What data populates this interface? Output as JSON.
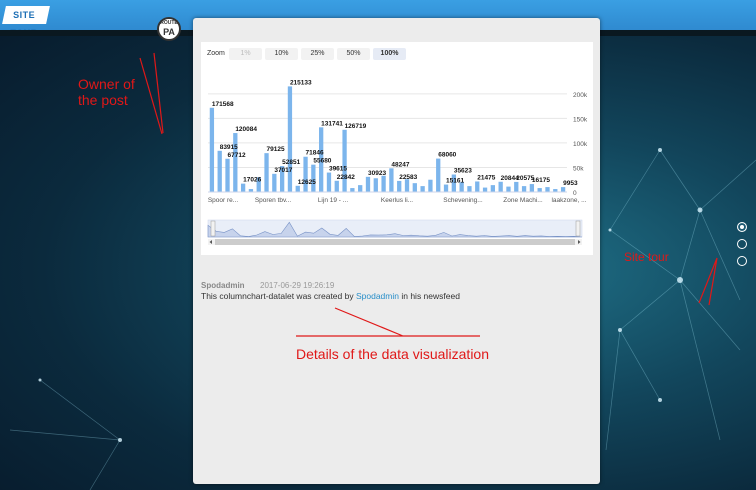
{
  "app": {
    "logo_text": "SITE TOUR"
  },
  "avatar": {
    "top_text": "ROUTE",
    "initials": "PA"
  },
  "chart": {
    "zoom_label": "Zoom",
    "zoom_options": [
      "1%",
      "10%",
      "25%",
      "50%",
      "100%"
    ],
    "zoom_selected": "100%",
    "accent": "#7cb5ec"
  },
  "post": {
    "author": "Spodadmin",
    "timestamp": "2017-06-29 19:26:19",
    "text_before": "This columnchart-datalet was created by ",
    "link_text": "Spodadmin",
    "text_after": " in his newsfeed"
  },
  "annotations": {
    "owner": "Owner of\nthe post",
    "site_tour": "Site tour",
    "details": "Details of the data visualization",
    "color": "#e01818"
  },
  "tour": {
    "steps": 3,
    "active": 1
  },
  "chart_data": {
    "type": "bar",
    "categories": [
      "Spoor re...",
      "Sporen tbv...",
      "Lijn 19 - ...",
      "Keerlus li...",
      "Schevening...",
      "Zone Machi...",
      "laakzone, ..."
    ],
    "values": [
      171568,
      83915,
      67712,
      120084,
      17026,
      6000,
      30000,
      79125,
      37017,
      52851,
      215133,
      12625,
      71846,
      55680,
      131741,
      39615,
      22842,
      126719,
      8000,
      14000,
      30923,
      28000,
      33000,
      48247,
      22583,
      26000,
      18000,
      12000,
      25000,
      68060,
      15161,
      35623,
      20000,
      12000,
      21475,
      9000,
      14000,
      20844,
      11000,
      20575,
      12000,
      16175,
      8000,
      10000,
      6000,
      9953
    ],
    "data_labels": [
      "171568",
      "83915",
      "67712",
      "120084",
      "17026",
      "79125",
      "37017",
      "52851",
      "215133",
      "12625",
      "71846",
      "55680",
      "131741",
      "39615",
      "22842",
      "126719",
      "30923",
      "48247",
      "22583",
      "68060",
      "15161",
      "35623",
      "21475",
      "20844",
      "20575",
      "16175",
      "9953"
    ],
    "y_ticks": [
      "200k",
      "150k",
      "100k",
      "50k",
      "0"
    ],
    "ylim": [
      0,
      220000
    ],
    "grid": true,
    "navigator": true
  }
}
